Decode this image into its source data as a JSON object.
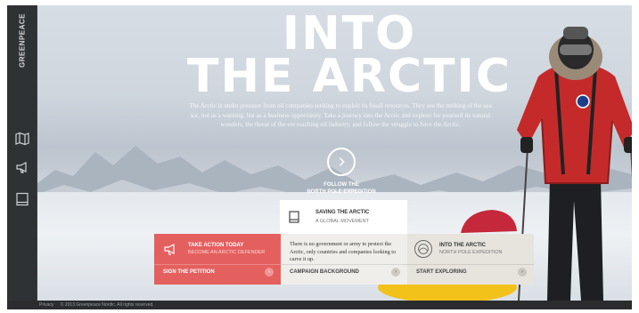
{
  "brand": {
    "logo_text": "GREENPEACE"
  },
  "sidebar": {
    "items": [
      {
        "icon": "map-icon"
      },
      {
        "icon": "megaphone-icon"
      },
      {
        "icon": "book-icon"
      }
    ]
  },
  "hero": {
    "title_line1": "INTO",
    "title_line2": "THE ARCTIC",
    "intro": "The Arctic is under pressure from oil companies seeking to exploit its fossil resources. They see the melting of the sea ice, not as a warning, but as a business opportunity. Take a journey into the Arctic and explore for yourself its natural wonders, the threat of the encroaching oil industry, and follow the struggle to Save the Arctic.",
    "follow_line1": "FOLLOW THE",
    "follow_line2": "NORTH POLE EXPEDITION"
  },
  "cards": {
    "saving": {
      "title": "SAVING THE ARCTIC",
      "subtitle": "A GLOBAL MOVEMENT"
    },
    "action": {
      "title": "TAKE ACTION TODAY",
      "subtitle": "BECOME AN ARCTIC DEFENDER",
      "cta": "SIGN THE PETITION"
    },
    "background": {
      "body": "There is no government or army to protect the Arctic, only countries and companies looking to carve it up.",
      "cta": "CAMPAIGN BACKGROUND"
    },
    "explore": {
      "title": "INTO THE ARCTIC",
      "subtitle": "NORTH POLE EXPEDITION",
      "cta": "START EXPLORING"
    }
  },
  "footer": {
    "privacy": "Privacy",
    "copyright": "© 2013 Greenpeace Nordic. All rights reserved."
  },
  "colors": {
    "accent": "#e4605f",
    "sidebar": "#2f3235",
    "footer": "#2a2c2e"
  }
}
